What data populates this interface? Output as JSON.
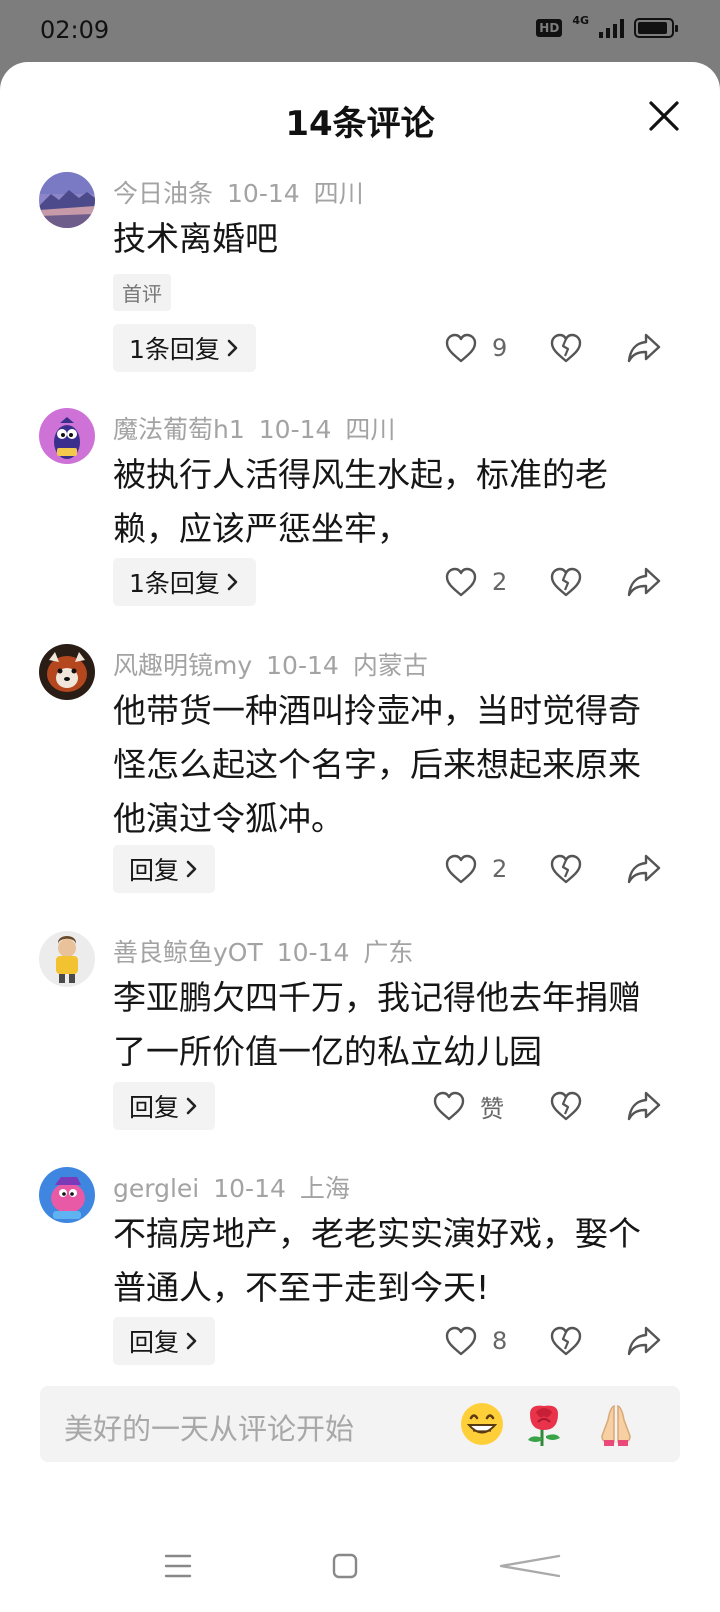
{
  "status": {
    "time": "02:09",
    "hd": "HD",
    "network": "4G",
    "battery_level": 0.9
  },
  "sheet": {
    "title": "14条评论"
  },
  "comments": [
    {
      "user": "今日油条",
      "date": "10-14",
      "location": "四川",
      "text": "技术离婚吧",
      "tag": "首评",
      "reply_label": "1条回复",
      "likes": "9",
      "avatar": "mountain-landscape"
    },
    {
      "user": "魔法葡萄h1",
      "date": "10-14",
      "location": "四川",
      "text": "被执行人活得风生水起，标准的老赖，应该严惩坐牢，",
      "reply_label": "1条回复",
      "likes": "2",
      "avatar": "purple-cartoon"
    },
    {
      "user": "风趣明镜my",
      "date": "10-14",
      "location": "内蒙古",
      "text": "他带货一种酒叫拎壶冲，当时觉得奇怪怎么起这个名字，后来想起来原来他演过令狐冲。",
      "reply_label": "回复",
      "likes": "2",
      "avatar": "red-panda"
    },
    {
      "user": "善良鲸鱼yOT",
      "date": "10-14",
      "location": "广东",
      "text": "李亚鹏欠四千万，我记得他去年捐赠了一所价值一亿的私立幼儿园",
      "reply_label": "回复",
      "likes": "赞",
      "avatar": "cartoon-boy"
    },
    {
      "user": "gerglei",
      "date": "10-14",
      "location": "上海",
      "text": "不搞房地产，老老实实演好戏，娶个普通人，不至于走到今天!",
      "reply_label": "回复",
      "likes": "8",
      "avatar": "pink-cartoon"
    }
  ],
  "input": {
    "placeholder": "美好的一天从评论开始",
    "emojis": [
      "grinning-emoji",
      "rose-emoji",
      "pray-emoji"
    ]
  }
}
